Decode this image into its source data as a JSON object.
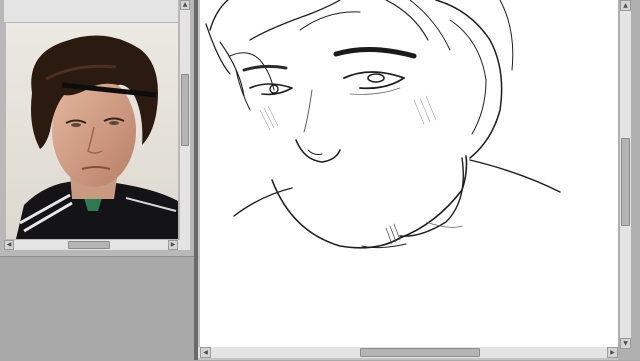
{
  "reference_panel": {
    "image": "reference-portrait-photo",
    "icons": {
      "scroll_up": "▲",
      "scroll_left": "◀",
      "scroll_right": "▶"
    }
  },
  "canvas_panel": {
    "image": "pencil-sketch-portrait",
    "icons": {
      "scroll_up": "▲",
      "scroll_down": "▼",
      "scroll_left": "◀",
      "scroll_right": "▶"
    }
  },
  "colors": {
    "panel_bg": "#b8b8b8",
    "canvas_bg": "#ffffff",
    "divider": "#6a6a6a"
  }
}
